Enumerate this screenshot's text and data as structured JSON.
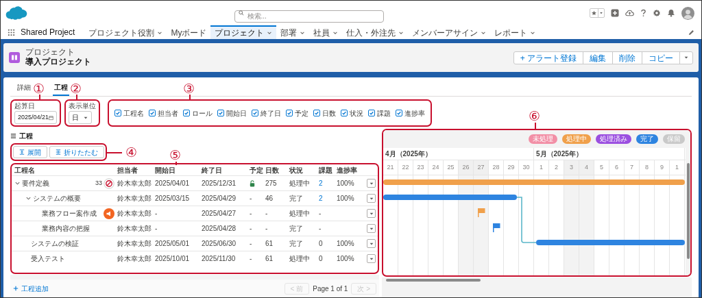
{
  "header": {
    "search": {
      "placeholder": "検索..."
    }
  },
  "nav": {
    "app_name": "Shared Project",
    "items": [
      {
        "label": "プロジェクト役割",
        "dropdown": true,
        "selected": false
      },
      {
        "label": "Myボード",
        "dropdown": false,
        "selected": false
      },
      {
        "label": "プロジェクト",
        "dropdown": true,
        "selected": true
      },
      {
        "label": "部署",
        "dropdown": true,
        "selected": false
      },
      {
        "label": "社員",
        "dropdown": true,
        "selected": false
      },
      {
        "label": "仕入・外注先",
        "dropdown": true,
        "selected": false
      },
      {
        "label": "メンバーアサイン",
        "dropdown": true,
        "selected": false
      },
      {
        "label": "レポート",
        "dropdown": true,
        "selected": false
      }
    ]
  },
  "record": {
    "object": "プロジェクト",
    "title": "導入プロジェクト",
    "actions": [
      "+ アラート登録",
      "編集",
      "削除",
      "コピー"
    ]
  },
  "tabs": [
    {
      "label": "詳細",
      "selected": false
    },
    {
      "label": "工程",
      "selected": true
    }
  ],
  "base_date": {
    "label": "起算日",
    "value": "2025/04/21"
  },
  "unit": {
    "label": "表示単位",
    "value": "日"
  },
  "column_filters": [
    {
      "label": "工程名",
      "checked": true
    },
    {
      "label": "担当者",
      "checked": true
    },
    {
      "label": "ロール",
      "checked": true
    },
    {
      "label": "開始日",
      "checked": true
    },
    {
      "label": "終了日",
      "checked": true
    },
    {
      "label": "予定",
      "checked": true
    },
    {
      "label": "日数",
      "checked": true
    },
    {
      "label": "状況",
      "checked": true
    },
    {
      "label": "課題",
      "checked": true
    },
    {
      "label": "進捗率",
      "checked": true
    }
  ],
  "section_title": "工程",
  "tree_buttons": [
    "展開",
    "折りたたむ"
  ],
  "table": {
    "columns": [
      "工程名",
      "担当者",
      "開始日",
      "終了日",
      "予定",
      "日数",
      "状況",
      "課題",
      "進捗率"
    ],
    "rows": [
      {
        "name": "要件定義",
        "expanded": true,
        "count": "33",
        "blocked": true,
        "announcement": false,
        "assignee": "鈴木幸太郎",
        "start": "2025/04/01",
        "end": "2025/12/31",
        "plan_locked": true,
        "days": "275",
        "status": "処理中",
        "issues": "2",
        "issues_link": true,
        "progress": "100%",
        "color": "#f0a04b",
        "children": [
          {
            "name": "システムの概要",
            "expanded": true,
            "blocked": false,
            "announcement": false,
            "assignee": "鈴木幸太郎",
            "start": "2025/03/15",
            "end": "2025/04/29",
            "plan_locked": false,
            "plan": "-",
            "days": "46",
            "status": "完了",
            "issues": "2",
            "issues_link": true,
            "progress": "100%",
            "color": "#2e84e0",
            "children": [
              {
                "name": "業務フロー案作成",
                "blocked": false,
                "announcement": true,
                "assignee": "鈴木幸太郎",
                "start": "-",
                "end": "2025/04/27",
                "plan_locked": false,
                "plan": "-",
                "days": "-",
                "status": "処理中",
                "issues": "-",
                "issues_link": false,
                "color": "#f0a04b"
              },
              {
                "name": "業務内容の把握",
                "blocked": false,
                "announcement": false,
                "assignee": "鈴木幸太郎",
                "start": "-",
                "end": "2025/04/28",
                "plan_locked": false,
                "plan": "-",
                "days": "-",
                "status": "完了",
                "issues": "-",
                "issues_link": false,
                "color": "#2e84e0"
              }
            ]
          },
          {
            "name": "システムの検証",
            "blocked": false,
            "announcement": false,
            "assignee": "鈴木幸太郎",
            "start": "2025/05/01",
            "end": "2025/06/30",
            "plan_locked": false,
            "plan": "-",
            "days": "61",
            "status": "完了",
            "issues": "0",
            "issues_link": false,
            "progress": "100%",
            "color": "#2e84e0",
            "follows_previous": true
          },
          {
            "name": "受入テスト",
            "blocked": false,
            "announcement": false,
            "assignee": "鈴木幸太郎",
            "start": "2025/10/01",
            "end": "2025/11/30",
            "plan_locked": false,
            "plan": "-",
            "days": "61",
            "status": "処理中",
            "issues": "0",
            "issues_link": false,
            "progress": "100%"
          }
        ]
      }
    ]
  },
  "footer": {
    "add": "工程追加",
    "prev": "< 前",
    "page": "Page 1 of 1",
    "next": "次 >"
  },
  "gantt": {
    "legend": [
      {
        "label": "未処理",
        "color": "#f28fa6"
      },
      {
        "label": "処理中",
        "color": "#f0a04b"
      },
      {
        "label": "処理済み",
        "color": "#9b4fe0"
      },
      {
        "label": "完了",
        "color": "#2e84e0"
      },
      {
        "label": "保留",
        "color": "#c9c9c9"
      }
    ],
    "months": [
      {
        "label": "4月（2025年）",
        "days": [
          {
            "label": "21",
            "weekend": false
          },
          {
            "label": "22",
            "weekend": false
          },
          {
            "label": "23",
            "weekend": false
          },
          {
            "label": "24",
            "weekend": false
          },
          {
            "label": "25",
            "weekend": false
          },
          {
            "label": "26",
            "weekend": true
          },
          {
            "label": "27",
            "weekend": true
          },
          {
            "label": "28",
            "weekend": false
          },
          {
            "label": "29",
            "weekend": false
          },
          {
            "label": "30",
            "weekend": false
          }
        ]
      },
      {
        "label": "5月（2025年）",
        "days": [
          {
            "label": "1",
            "weekend": false
          },
          {
            "label": "2",
            "weekend": false
          },
          {
            "label": "3",
            "weekend": true
          },
          {
            "label": "4",
            "weekend": true
          },
          {
            "label": "5",
            "weekend": false
          },
          {
            "label": "6",
            "weekend": false
          },
          {
            "label": "7",
            "weekend": false
          },
          {
            "label": "8",
            "weekend": false
          },
          {
            "label": "9",
            "weekend": false
          },
          {
            "label": "1",
            "weekend": false
          }
        ]
      }
    ]
  },
  "callouts": [
    "①",
    "②",
    "③",
    "④",
    "⑤",
    "⑥"
  ]
}
